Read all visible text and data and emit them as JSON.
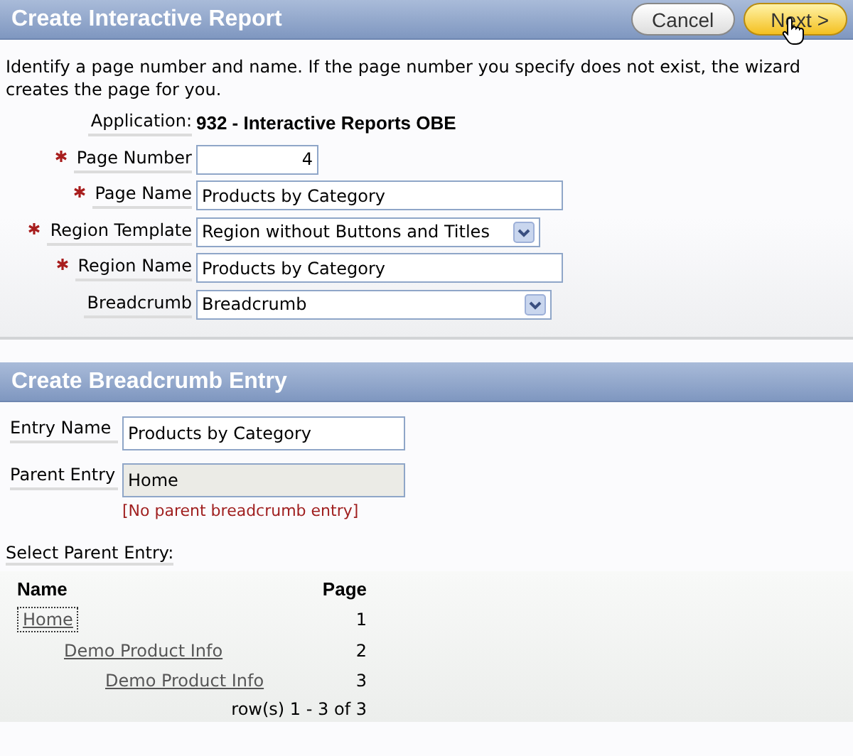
{
  "header": {
    "title": "Create Interactive Report",
    "buttons": [
      {
        "label": "Cancel",
        "kind": "secondary"
      },
      {
        "label": "Next >",
        "kind": "primary"
      }
    ]
  },
  "intro": "Identify a page number and name. If the page number you specify does not exist, the wizard creates the page for you.",
  "application": {
    "label": "Application:",
    "value": "932 - Interactive Reports OBE"
  },
  "fields": [
    {
      "label": "Page Number",
      "required": true,
      "kind": "number",
      "value": "4"
    },
    {
      "label": "Page Name",
      "required": true,
      "kind": "text",
      "value": "Products by Category"
    },
    {
      "label": "Region Template",
      "required": true,
      "kind": "select",
      "value": "Region without Buttons and Titles"
    },
    {
      "label": "Region Name",
      "required": true,
      "kind": "text",
      "value": "Products by Category"
    },
    {
      "label": "Breadcrumb",
      "required": false,
      "kind": "select",
      "value": "Breadcrumb"
    }
  ],
  "section2": {
    "title": "Create Breadcrumb Entry",
    "fields": [
      {
        "label": "Entry Name",
        "value": "Products by Category",
        "disabled": false
      },
      {
        "label": "Parent Entry",
        "value": "Home",
        "disabled": true,
        "note": "[No parent breadcrumb entry]"
      }
    ],
    "select_label": "Select Parent Entry:",
    "table": {
      "columns": [
        "Name",
        "Page"
      ],
      "rows": [
        {
          "name": "Home",
          "page": "1",
          "focused": true,
          "children": [
            {
              "name": "Demo Product Info",
              "page": "2",
              "focused": false,
              "children": [
                {
                  "name": "Demo Product Info",
                  "page": "3",
                  "focused": false
                }
              ]
            }
          ]
        }
      ],
      "pagination": "row(s) 1 - 3 of 3"
    }
  }
}
